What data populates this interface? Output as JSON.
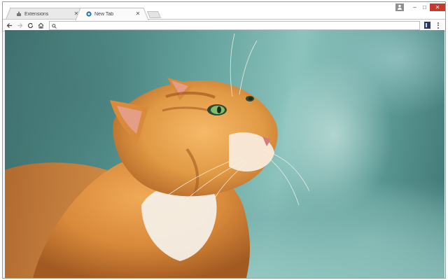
{
  "tabs": [
    {
      "title": "Extensions",
      "active": false,
      "favicon": "puzzle-icon"
    },
    {
      "title": "New Tab",
      "active": true,
      "favicon": "extension-logo-icon"
    }
  ],
  "toolbar": {
    "search": {
      "value": "",
      "placeholder": ""
    }
  },
  "icons": {
    "back": "back-arrow-icon",
    "forward": "forward-arrow-icon",
    "reload": "reload-icon",
    "home": "home-icon",
    "search": "search-icon",
    "extension": "extension-icon",
    "menu": "kebab-menu-icon",
    "profile": "profile-icon",
    "minimize": "minimize-icon",
    "maximize": "maximize-icon",
    "close": "close-icon"
  },
  "colors": {
    "close_button": "#c9392b",
    "background_teal": "#6aa7a2",
    "cat_orange": "#d98a3a"
  },
  "content": {
    "background_image": "ginger cat looking up"
  }
}
